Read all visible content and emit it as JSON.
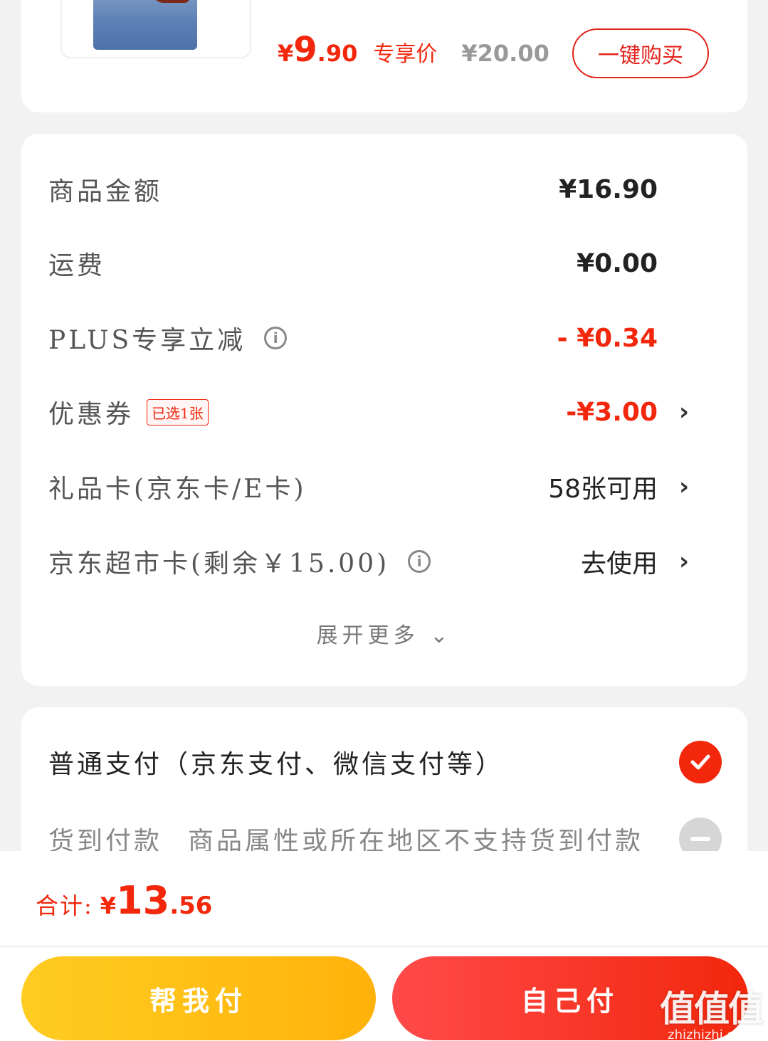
{
  "product": {
    "price_currency": "¥",
    "price_int": "9",
    "price_dec": ".90",
    "price_label": "专享价",
    "original_price": "¥20.00",
    "buy_button": "一键购买"
  },
  "summary": {
    "rows": [
      {
        "label": "商品金额",
        "value": "¥16.90"
      },
      {
        "label": "运费",
        "value": "¥0.00"
      },
      {
        "label": "PLUS专享立减",
        "value": "- ¥0.34"
      },
      {
        "label": "优惠券",
        "tag": "已选1张",
        "value": "-¥3.00"
      },
      {
        "label": "礼品卡(京东卡/E卡)",
        "value": "58张可用"
      },
      {
        "label": "京东超市卡(剩余￥15.00)",
        "value": "去使用"
      }
    ],
    "expand": "展开更多"
  },
  "payment": {
    "normal": "普通支付（京东支付、微信支付等）",
    "cod": "货到付款",
    "cod_note": "商品属性或所在地区不支持货到付款"
  },
  "bottom": {
    "total_label": "合计:",
    "total_currency": "¥",
    "total_int": "13",
    "total_dec": ".56",
    "help_pay": "帮我付",
    "self_pay": "自己付"
  },
  "watermark": {
    "logo": "值值值",
    "site": "zhizhizhi.com"
  },
  "colors": {
    "accent": "#f2270c",
    "help_button": "#ffb20a"
  }
}
